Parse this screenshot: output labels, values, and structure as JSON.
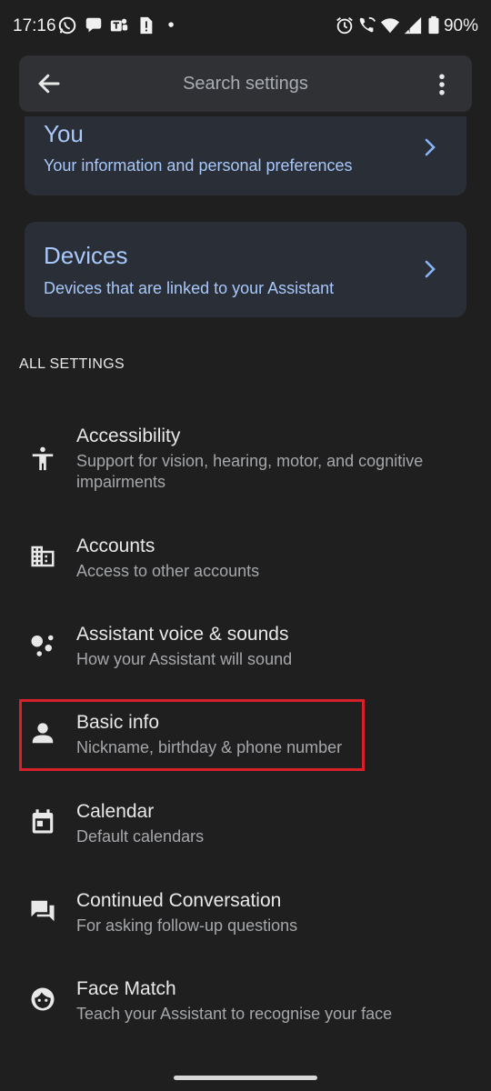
{
  "status_bar": {
    "time": "17:16",
    "battery": "90%"
  },
  "search": {
    "placeholder": "Search settings"
  },
  "cards": {
    "you": {
      "title": "You",
      "subtitle": "Your information and personal preferences"
    },
    "devices": {
      "title": "Devices",
      "subtitle": "Devices that are linked to your Assistant"
    }
  },
  "section_header": "ALL SETTINGS",
  "settings": [
    {
      "icon": "accessibility-icon",
      "title": "Accessibility",
      "subtitle": "Support for vision, hearing, motor, and cognitive impairments"
    },
    {
      "icon": "building-icon",
      "title": "Accounts",
      "subtitle": "Access to other accounts"
    },
    {
      "icon": "assistant-dots-icon",
      "title": "Assistant voice & sounds",
      "subtitle": "How your Assistant will sound"
    },
    {
      "icon": "person-icon",
      "title": "Basic info",
      "subtitle": "Nickname, birthday & phone number",
      "highlighted": true
    },
    {
      "icon": "calendar-icon",
      "title": "Calendar",
      "subtitle": "Default calendars"
    },
    {
      "icon": "chat-bubbles-icon",
      "title": "Continued Conversation",
      "subtitle": "For asking follow-up questions"
    },
    {
      "icon": "face-icon",
      "title": "Face Match",
      "subtitle": "Teach your Assistant to recognise your face"
    }
  ],
  "colors": {
    "background": "#1f1f1f",
    "card": "#2a2f37",
    "accent": "#a8c7fa",
    "highlight": "#d6202a"
  }
}
